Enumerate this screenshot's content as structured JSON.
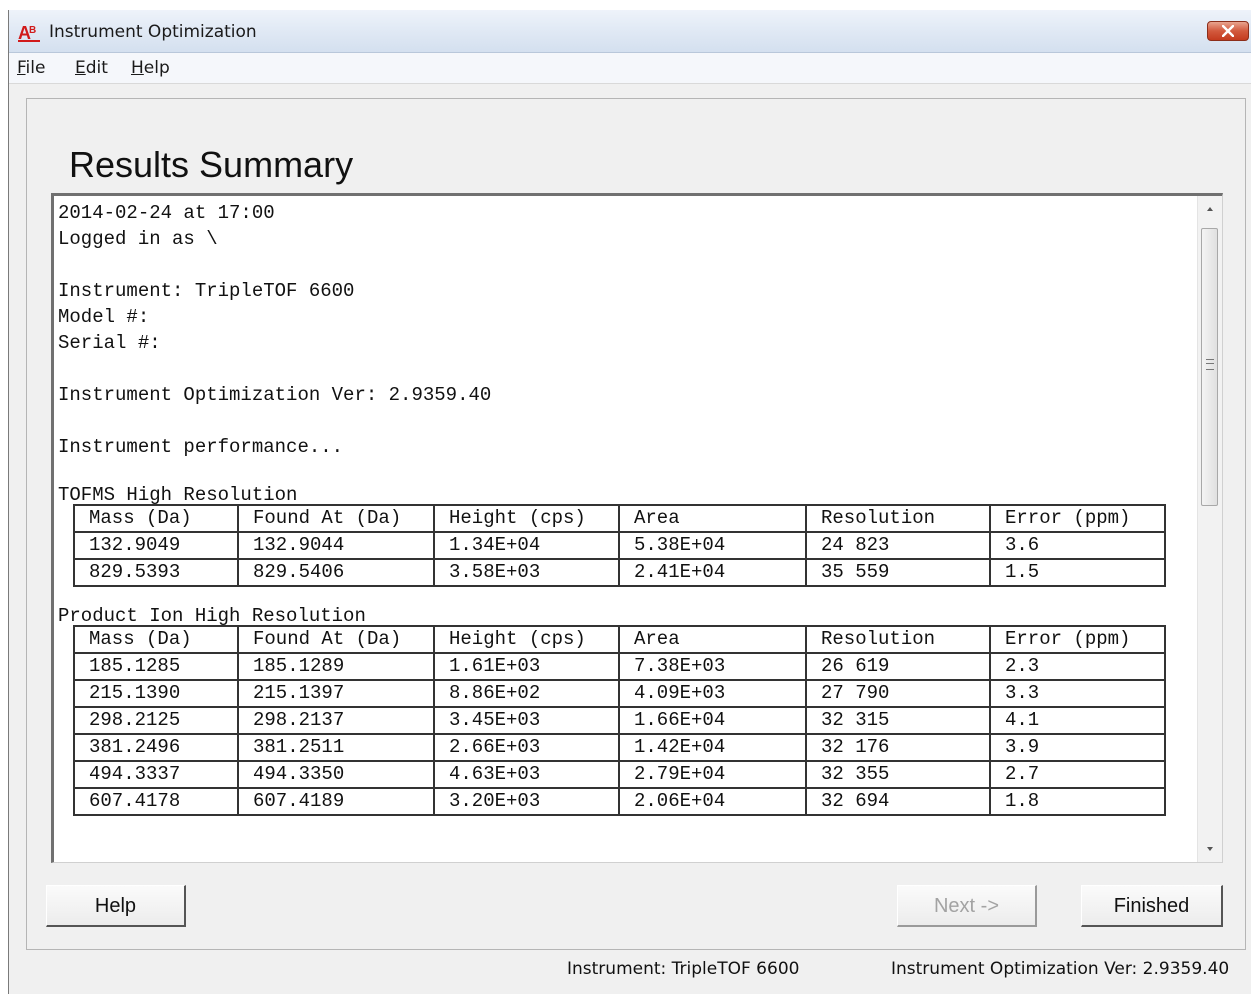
{
  "window": {
    "title": "Instrument Optimization",
    "app_icon": "ab-sciex-icon",
    "close_color": "#c43b1f"
  },
  "menu": {
    "file": "File",
    "edit": "Edit",
    "help": "Help"
  },
  "heading": "Results Summary",
  "report": {
    "date_line": "2014-02-24 at 17:00",
    "logged_line": "Logged in as \\",
    "instrument_line": "Instrument: TripleTOF 6600",
    "model_line": "Model #:",
    "serial_line": "Serial #:",
    "version_line": "Instrument Optimization Ver: 2.9359.40",
    "performance_line": "Instrument performance...",
    "tofms_title": "TOFMS High Resolution",
    "product_title": "Product Ion High Resolution",
    "columns": [
      "Mass (Da)",
      "Found At (Da)",
      "Height (cps)",
      "Area",
      "Resolution",
      "Error (ppm)"
    ],
    "tofms_rows": [
      [
        "132.9049",
        "132.9044",
        "1.34E+04",
        "5.38E+04",
        "24 823",
        "3.6"
      ],
      [
        "829.5393",
        "829.5406",
        "3.58E+03",
        "2.41E+04",
        "35 559",
        "1.5"
      ]
    ],
    "product_rows": [
      [
        "185.1285",
        "185.1289",
        "1.61E+03",
        "7.38E+03",
        "26 619",
        "2.3"
      ],
      [
        "215.1390",
        "215.1397",
        "8.86E+02",
        "4.09E+03",
        "27 790",
        "3.3"
      ],
      [
        "298.2125",
        "298.2137",
        "3.45E+03",
        "1.66E+04",
        "32 315",
        "4.1"
      ],
      [
        "381.2496",
        "381.2511",
        "2.66E+03",
        "1.42E+04",
        "32 176",
        "3.9"
      ],
      [
        "494.3337",
        "494.3350",
        "4.63E+03",
        "2.79E+04",
        "32 355",
        "2.7"
      ],
      [
        "607.4178",
        "607.4189",
        "3.20E+03",
        "2.06E+04",
        "32 694",
        "1.8"
      ]
    ]
  },
  "buttons": {
    "help": "Help",
    "next": "Next ->",
    "finished": "Finished"
  },
  "status": {
    "instrument": "Instrument: TripleTOF 6600",
    "version": "Instrument Optimization Ver: 2.9359.40"
  }
}
